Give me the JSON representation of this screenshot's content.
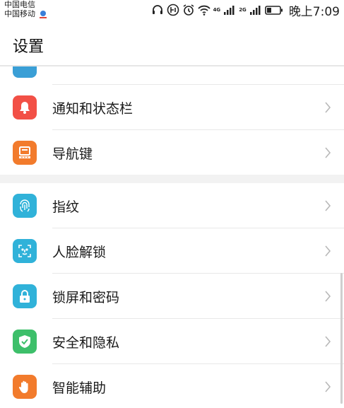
{
  "status_bar": {
    "carrier_1": "中国电信",
    "carrier_2": "中国移动",
    "net_4g": "4G",
    "net_2g": "2G",
    "time": "晚上7:09"
  },
  "header": {
    "title": "设置"
  },
  "settings": [
    {
      "label": "通知和状态栏",
      "icon": "bell-icon",
      "color": "#f25046"
    },
    {
      "label": "导航键",
      "icon": "navigation-key-icon",
      "color": "#f27b2c"
    },
    {
      "label": "指纹",
      "icon": "fingerprint-icon",
      "color": "#30b2d9"
    },
    {
      "label": "人脸解锁",
      "icon": "face-unlock-icon",
      "color": "#30b2d9"
    },
    {
      "label": "锁屏和密码",
      "icon": "lock-icon",
      "color": "#30b2d9"
    },
    {
      "label": "安全和隐私",
      "icon": "shield-check-icon",
      "color": "#3dbf6a"
    },
    {
      "label": "智能辅助",
      "icon": "hand-icon",
      "color": "#f27b2c"
    }
  ]
}
